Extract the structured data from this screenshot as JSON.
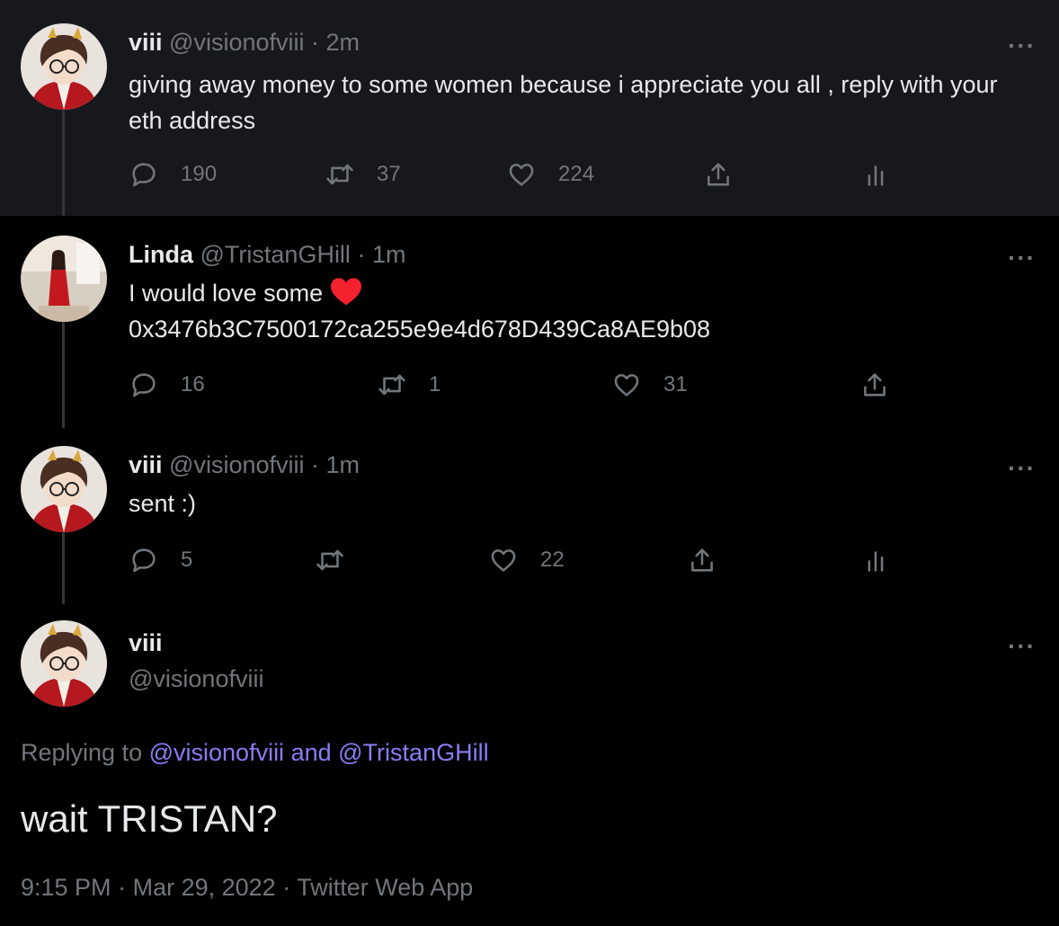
{
  "tweets": [
    {
      "name": "viii",
      "handle": "@visionofviii",
      "time": "2m",
      "text": "giving away money to some women because i appreciate you all , reply with your eth address",
      "replies": "190",
      "retweets": "37",
      "likes": "224"
    },
    {
      "name": "Linda",
      "handle": "@TristanGHill",
      "time": "1m",
      "text_line1": "I would love some",
      "text_line2": "0x3476b3C7500172ca255e9e4d678D439Ca8AE9b08",
      "replies": "16",
      "retweets": "1",
      "likes": "31"
    },
    {
      "name": "viii",
      "handle": "@visionofviii",
      "time": "1m",
      "text": "sent :)",
      "replies": "5",
      "retweets": "",
      "likes": "22"
    }
  ],
  "main": {
    "name": "viii",
    "handle": "@visionofviii",
    "replying_prefix": "Replying to",
    "mention1": "@visionofviii",
    "and": "and",
    "mention2": "@TristanGHill",
    "text": "wait TRISTAN?",
    "time": "9:15 PM",
    "date": "Mar 29, 2022",
    "source": "Twitter Web App"
  },
  "ui": {
    "separator": "·",
    "more": "···"
  },
  "colors": {
    "accent": "#8b7cf5",
    "heart": "#f4212e",
    "muted": "#71767b"
  },
  "icons": [
    "reply-icon",
    "retweet-icon",
    "like-icon",
    "share-icon",
    "analytics-icon",
    "more-icon",
    "heart-emoji"
  ]
}
